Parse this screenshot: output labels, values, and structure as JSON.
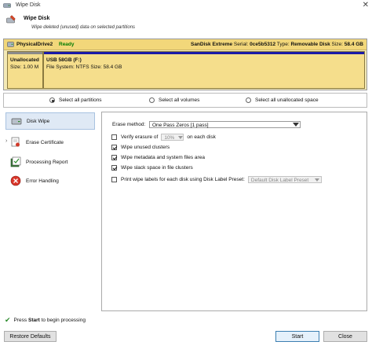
{
  "window": {
    "title": "Wipe Disk",
    "close_glyph": "✕"
  },
  "header": {
    "title": "Wipe Disk",
    "subtitle": "Wipe deleted (unused) data on selected partitions"
  },
  "disk": {
    "name": "PhysicalDrive2",
    "status": "Ready",
    "model": "SanDisk Extreme",
    "serial_label": "Serial:",
    "serial": "0ce5b5312",
    "type_label": "Type:",
    "type": "Removable Disk",
    "size_label": "Size:",
    "size": "58.4 GB",
    "partitions": [
      {
        "line1": "Unallocated",
        "line2": "Size: 1.00 M"
      },
      {
        "line1": "USB 58GB (F:)",
        "line2": "File System: NTFS Size: 58.4 GB"
      }
    ]
  },
  "selection": {
    "options": [
      "Select all partitions",
      "Select all volumes",
      "Select all unallocated space"
    ],
    "selected_index": 0
  },
  "nav": {
    "items": [
      {
        "label": "Disk Wipe",
        "icon": "disk-wipe-icon"
      },
      {
        "label": "Erase Certificate",
        "icon": "certificate-icon"
      },
      {
        "label": "Processing Report",
        "icon": "report-icon"
      },
      {
        "label": "Error Handling",
        "icon": "error-icon"
      }
    ],
    "selected_index": 0
  },
  "settings": {
    "erase_method_label": "Erase method:",
    "erase_method_value": "One Pass Zeros [1 pass]",
    "verify_label_pre": "Verify erasure of",
    "verify_value": "10%",
    "verify_label_post": "on each disk",
    "verify_checked": false,
    "wipe_unused_label": "Wipe unused clusters",
    "wipe_unused_checked": true,
    "wipe_metadata_label": "Wipe metadata and system files area",
    "wipe_metadata_checked": true,
    "wipe_slack_label": "Wipe slack space in file clusters",
    "wipe_slack_checked": true,
    "print_labels_label": "Print wipe labels for each disk using Disk Label Preset:",
    "print_labels_checked": false,
    "label_preset_value": "Default Disk Label Preset"
  },
  "status": {
    "pre": "Press",
    "bold": "Start",
    "post": "to begin processing"
  },
  "buttons": {
    "restore": "Restore Defaults",
    "start": "Start",
    "close": "Close"
  },
  "colors": {
    "partition_bar": "#1a1aa8",
    "disk_header": "#f2d77a",
    "ready": "#007a00"
  }
}
